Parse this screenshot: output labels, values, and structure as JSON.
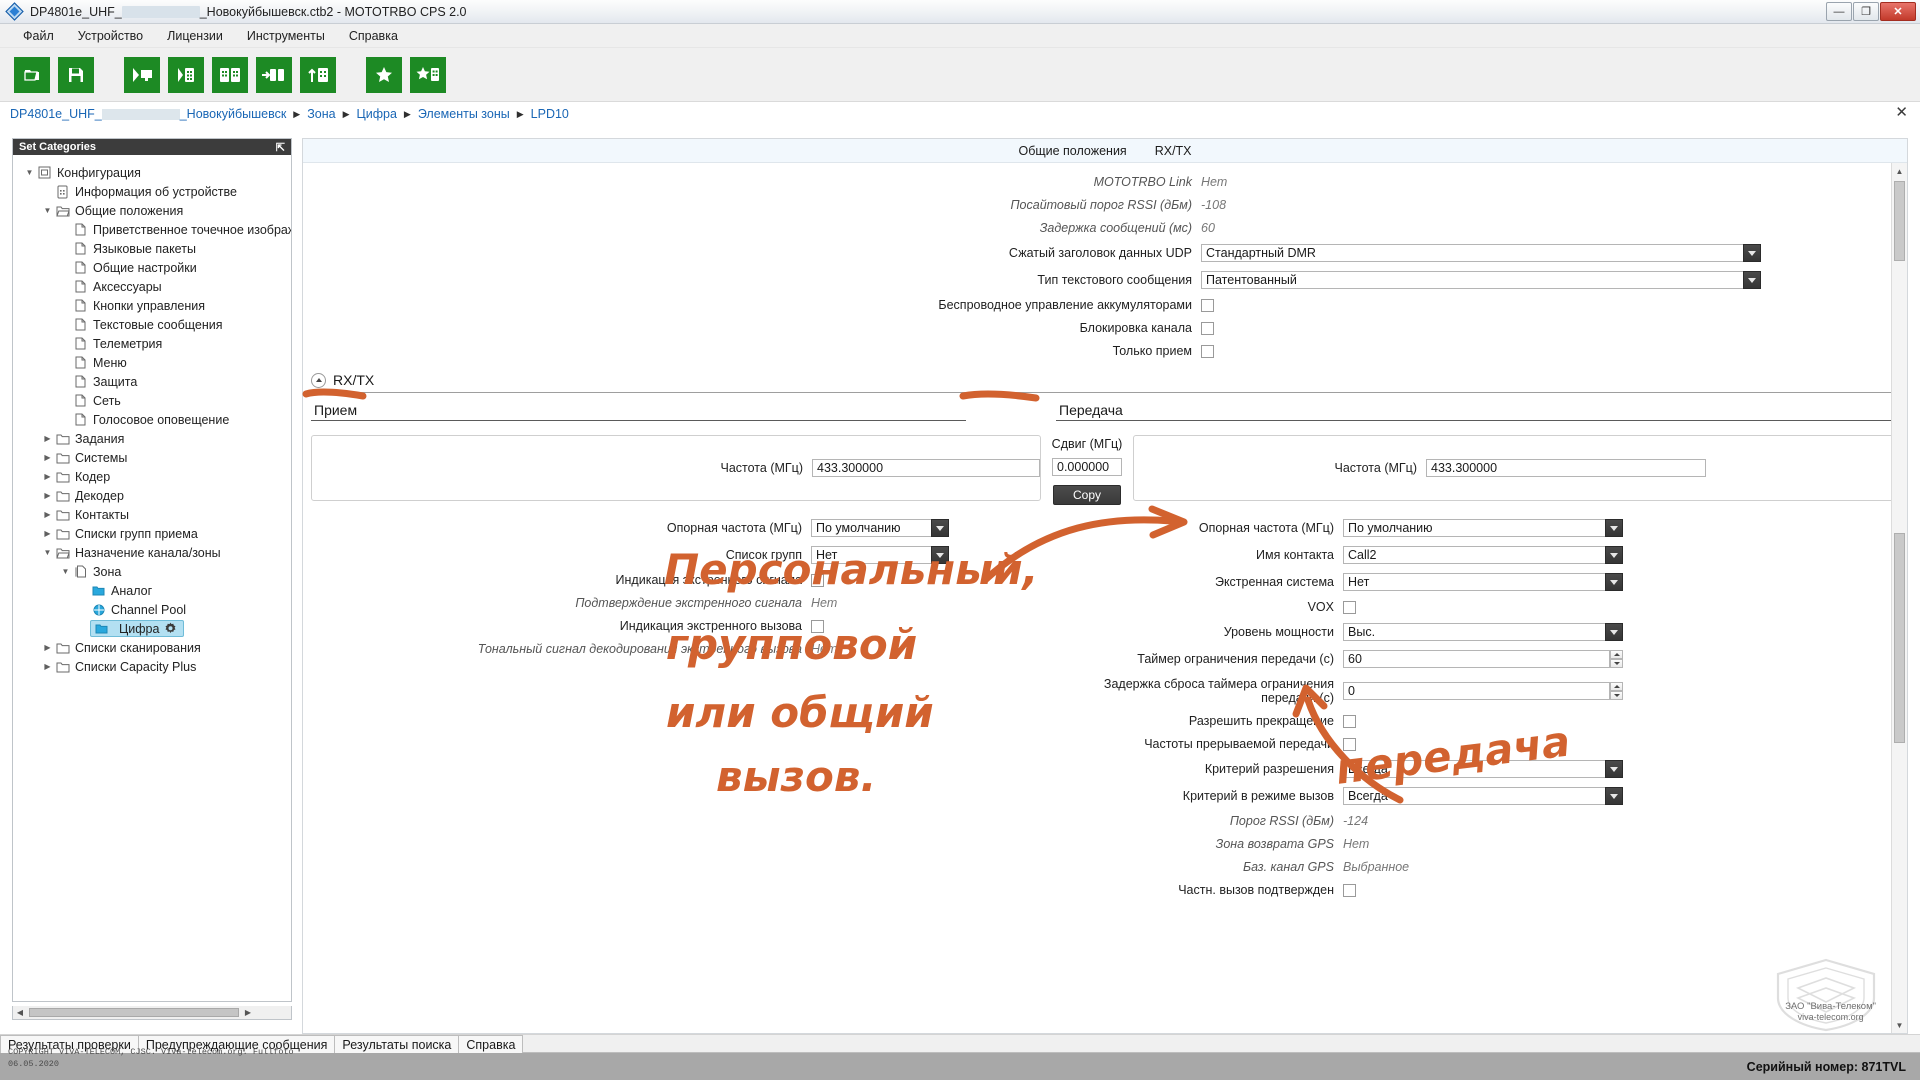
{
  "window": {
    "title_prefix": "DP4801e_UHF_",
    "title_suffix": "_Новокуйбышевск.ctb2 - MOTOTRBO CPS 2.0",
    "minimize": "—",
    "maximize": "❐",
    "close": "✕"
  },
  "menu": [
    "Файл",
    "Устройство",
    "Лицензии",
    "Инструменты",
    "Справка"
  ],
  "toolbar": [
    {
      "name": "open-icon",
      "glyph": "folder"
    },
    {
      "name": "save-icon",
      "glyph": "save"
    },
    {
      "name": "read-device-icon",
      "glyph": "read"
    },
    {
      "name": "write-device-icon",
      "glyph": "write"
    },
    {
      "name": "clone-icon",
      "glyph": "clone"
    },
    {
      "name": "import-icon",
      "glyph": "import"
    },
    {
      "name": "export-icon",
      "glyph": "export"
    },
    {
      "name": "favorites-icon",
      "glyph": "star"
    },
    {
      "name": "add-favorite-icon",
      "glyph": "staradd"
    }
  ],
  "breadcrumb": {
    "first": "DP4801e_UHF_",
    "items": [
      "_Новокуйбышевск",
      "Зона",
      "Цифра",
      "Элементы зоны",
      "LPD10"
    ],
    "close": "✕"
  },
  "sidebar": {
    "header": "Set Categories",
    "pin": "⇱",
    "tree": [
      {
        "label": "Конфигурация",
        "icon": "config-icon",
        "depth": 0,
        "arrow": "▼"
      },
      {
        "label": "Информация об устройстве",
        "icon": "device-icon",
        "depth": 1,
        "arrow": ""
      },
      {
        "label": "Общие положения",
        "icon": "folder-open-icon",
        "depth": 1,
        "arrow": "▼"
      },
      {
        "label": "Приветственное точечное изображение",
        "icon": "page-icon",
        "depth": 2,
        "arrow": ""
      },
      {
        "label": "Языковые пакеты",
        "icon": "page-icon",
        "depth": 2,
        "arrow": ""
      },
      {
        "label": "Общие настройки",
        "icon": "page-icon",
        "depth": 2,
        "arrow": ""
      },
      {
        "label": "Аксессуары",
        "icon": "page-icon",
        "depth": 2,
        "arrow": ""
      },
      {
        "label": "Кнопки управления",
        "icon": "page-icon",
        "depth": 2,
        "arrow": ""
      },
      {
        "label": "Текстовые сообщения",
        "icon": "page-icon",
        "depth": 2,
        "arrow": ""
      },
      {
        "label": "Телеметрия",
        "icon": "page-icon",
        "depth": 2,
        "arrow": ""
      },
      {
        "label": "Меню",
        "icon": "page-icon",
        "depth": 2,
        "arrow": ""
      },
      {
        "label": "Защита",
        "icon": "page-icon",
        "depth": 2,
        "arrow": ""
      },
      {
        "label": "Сеть",
        "icon": "page-icon",
        "depth": 2,
        "arrow": ""
      },
      {
        "label": "Голосовое оповещение",
        "icon": "page-icon",
        "depth": 2,
        "arrow": ""
      },
      {
        "label": "Задания",
        "icon": "folder-icon",
        "depth": 1,
        "arrow": "▶"
      },
      {
        "label": "Системы",
        "icon": "folder-icon",
        "depth": 1,
        "arrow": "▶"
      },
      {
        "label": "Кодер",
        "icon": "folder-icon",
        "depth": 1,
        "arrow": "▶"
      },
      {
        "label": "Декодер",
        "icon": "folder-icon",
        "depth": 1,
        "arrow": "▶"
      },
      {
        "label": "Контакты",
        "icon": "folder-icon",
        "depth": 1,
        "arrow": "▶"
      },
      {
        "label": "Списки групп приема",
        "icon": "folder-icon",
        "depth": 1,
        "arrow": "▶"
      },
      {
        "label": "Назначение канала/зоны",
        "icon": "folder-open-icon",
        "depth": 1,
        "arrow": "▼"
      },
      {
        "label": "Зона",
        "icon": "page-stack-icon",
        "depth": 2,
        "arrow": "▼"
      },
      {
        "label": "Аналог",
        "icon": "blue-folder-icon",
        "depth": 3,
        "arrow": ""
      },
      {
        "label": "Channel Pool",
        "icon": "pool-icon",
        "depth": 3,
        "arrow": ""
      },
      {
        "label": "Цифра",
        "icon": "blue-folder-icon",
        "depth": 3,
        "arrow": "",
        "selected": true,
        "badge": "gear-icon"
      },
      {
        "label": "Списки сканирования",
        "icon": "folder-icon",
        "depth": 1,
        "arrow": "▶"
      },
      {
        "label": "Списки Capacity Plus",
        "icon": "folder-icon",
        "depth": 1,
        "arrow": "▶"
      }
    ]
  },
  "main": {
    "tabs": [
      "Общие положения",
      "RX/TX"
    ],
    "general_rows": [
      {
        "label": "MOTOTRBO Link",
        "value": "Нет",
        "type": "readonly"
      },
      {
        "label": "Посайтовый порог RSSI (дБм)",
        "value": "-108",
        "type": "readonly"
      },
      {
        "label": "Задержка сообщений (мс)",
        "value": "60",
        "type": "readonly"
      },
      {
        "label": "Сжатый заголовок данных UDP",
        "value": "Стандартный DMR",
        "type": "combo"
      },
      {
        "label": "Тип текстового сообщения",
        "value": "Патентованный",
        "type": "combo"
      },
      {
        "label": "Беспроводное управление аккумуляторами",
        "value": "",
        "type": "checkbox"
      },
      {
        "label": "Блокировка канала",
        "value": "",
        "type": "checkbox"
      },
      {
        "label": "Только прием",
        "value": "",
        "type": "checkbox"
      }
    ],
    "rxtx": {
      "section_title": "RX/TX",
      "rx_title": "Прием",
      "tx_title": "Передача",
      "offset_label": "Сдвиг (МГц)",
      "offset_value": "0.000000",
      "copy_label": "Copy",
      "rx_freq_label": "Частота (МГц)",
      "rx_freq_value": "433.300000",
      "tx_freq_label": "Частота (МГц)",
      "tx_freq_value": "433.300000",
      "rx_rows": [
        {
          "label": "Опорная частота (МГц)",
          "value": "По умолчанию",
          "type": "combo"
        },
        {
          "label": "Список групп",
          "value": "Нет",
          "type": "combo"
        },
        {
          "label": "Индикация экстренного сигнала",
          "value": "",
          "type": "checkbox"
        },
        {
          "label": "Подтверждение экстренного сигнала",
          "value": "Нет",
          "type": "readonly"
        },
        {
          "label": "Индикация экстренного вызова",
          "value": "",
          "type": "checkbox"
        },
        {
          "label": "Тональный сигнал декодирования экстренного вызова",
          "value": "Нет",
          "type": "readonly"
        }
      ],
      "tx_rows": [
        {
          "label": "Опорная частота (МГц)",
          "value": "По умолчанию",
          "type": "combo"
        },
        {
          "label": "Имя контакта",
          "value": "Call2",
          "type": "combo"
        },
        {
          "label": "Экстренная система",
          "value": "Нет",
          "type": "combo"
        },
        {
          "label": "VOX",
          "value": "",
          "type": "checkbox"
        },
        {
          "label": "Уровень мощности",
          "value": "Выс.",
          "type": "combo"
        },
        {
          "label": "Таймер ограничения передачи (с)",
          "value": "60",
          "type": "spin"
        },
        {
          "label": "Задержка сброса таймера ограничения передачи (с)",
          "value": "0",
          "type": "spin"
        },
        {
          "label": "Разрешить прекращение",
          "value": "",
          "type": "checkbox"
        },
        {
          "label": "Частоты прерываемой передачи",
          "value": "",
          "type": "checkbox"
        },
        {
          "label": "Критерий разрешения",
          "value": "Всегда",
          "type": "combo"
        },
        {
          "label": "Критерий в режиме вызов",
          "value": "Всегда",
          "type": "combo"
        },
        {
          "label": "Порог RSSI (дБм)",
          "value": "-124",
          "type": "readonly"
        },
        {
          "label": "Зона возврата GPS",
          "value": "Нет",
          "type": "readonly"
        },
        {
          "label": "Баз. канал GPS",
          "value": "Выбранное",
          "type": "readonly"
        },
        {
          "label": "Частн. вызов подтвержден",
          "value": "",
          "type": "checkbox"
        }
      ]
    }
  },
  "annotations": [
    {
      "text": "Персональный,",
      "name": "annotation-personalnyy"
    },
    {
      "text": "групповой",
      "name": "annotation-gruppovoy"
    },
    {
      "text": "или общий",
      "name": "annotation-ili-obshchiy"
    },
    {
      "text": "вызов.",
      "name": "annotation-vyzov"
    },
    {
      "text": "передача",
      "name": "annotation-peredacha"
    }
  ],
  "bottom": {
    "tabs": [
      "Результаты проверки",
      "Предупреждающие сообщения",
      "Результаты поиска",
      "Справка"
    ],
    "copyright_line1": "COPYRIGHT VIVA-TELECOM, CJSC. Viva-telecom.org. Fullfoto",
    "copyright_line2": "06.05.2020",
    "serial": "Серийный номер: 871TVL",
    "watermark_company": "ЗАО \"Вива-Телеком\"",
    "watermark_site": "viva-telecom.org"
  },
  "colors": {
    "toolbar_green": "#1d8a24",
    "link_blue": "#1966b5",
    "selection_blue": "#b3e0f2",
    "annotation_orange": "#d2622f",
    "statusbar_gray": "#a8a8a8"
  }
}
